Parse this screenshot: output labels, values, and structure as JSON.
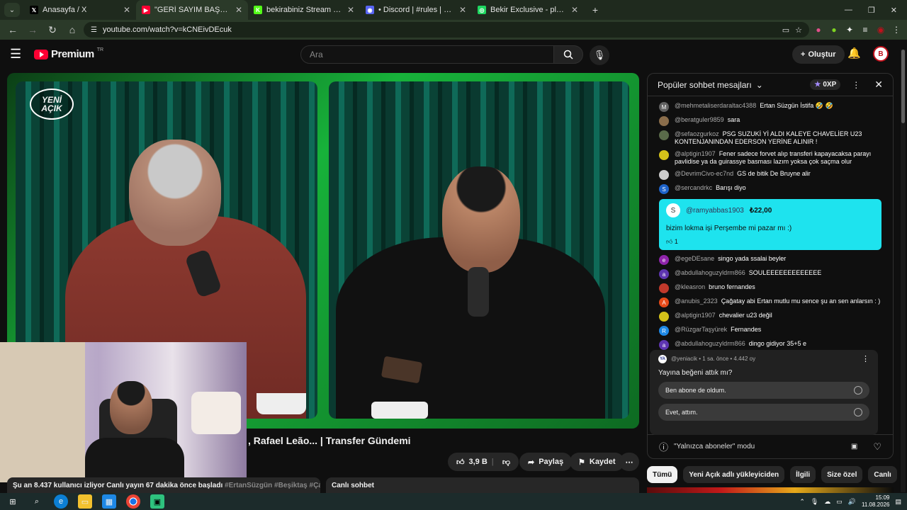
{
  "browser": {
    "tabs": [
      {
        "label": "Anasayfa / X",
        "icon": "x-logo-icon",
        "icon_glyph": "𝕏",
        "icon_bg": "#000000",
        "close": "✕"
      },
      {
        "label": "\"GERİ SAYIM BAŞLADI!\" Du",
        "icon": "youtube-icon",
        "icon_glyph": "▶",
        "icon_bg": "#ff0033",
        "close": "✕",
        "active": true
      },
      {
        "label": "bekirabiniz Stream - Watch Live",
        "icon": "kick-icon",
        "icon_glyph": "K",
        "icon_bg": "#53fc18",
        "close": "✕"
      },
      {
        "label": "• Discord | #rules | bekirabiniz",
        "icon": "discord-icon",
        "icon_glyph": "◉",
        "icon_bg": "#5865f2",
        "close": "✕"
      },
      {
        "label": "Bekir Exclusive - playlist by Bek",
        "icon": "spotify-icon",
        "icon_glyph": "◎",
        "icon_bg": "#1ed760",
        "close": "✕"
      }
    ],
    "new_tab": "+",
    "url": "youtube.com/watch?v=kCNEivDEcuk"
  },
  "header": {
    "logo_text": "Premium",
    "logo_region": "TR",
    "search_placeholder": "Ara",
    "create_label": "Oluştur"
  },
  "video": {
    "title": ", Rafael Leão... | Transfer Gündemi",
    "channel_watermark_line1": "YENİ",
    "channel_watermark_line2": "AÇIK",
    "like_count": "3,9 B",
    "share_label": "Paylaş",
    "save_label": "Kaydet",
    "description_line": "Şu an 8.437 kullanıcı izliyor  Canlı yayın 67 dakika önce başladı",
    "description_tags": "#ErtanSüzgün #Beşiktaş #ÇağataySö",
    "live_chat_label": "Canlı sohbet"
  },
  "chat": {
    "header_title": "Popüler sohbet mesajları",
    "xp_label": "0XP",
    "messages": [
      {
        "user": "@mehmetaliserdaraltac4388",
        "text": "Ertan Süzgün İstifa 🤣 🤣",
        "avatar": "M",
        "color": "#616161"
      },
      {
        "user": "@beratguler9859",
        "text": "sara",
        "avatar": "",
        "color": "#8a6d4b"
      },
      {
        "user": "@sefaozgurkoz",
        "text": "PSG SUZUKİ Yİ ALDI KALEYE CHAVELİER U23 KONTENJANINDAN EDERSON YERİNE ALINIR !",
        "avatar": "",
        "color": "#5a6b4a"
      },
      {
        "user": "@alptigin1907",
        "text": "Fener sadece forvet alıp transferi kapayacaksa parayı pavlidise ya da guirassye basması lazım yoksa çok saçma olur",
        "avatar": "",
        "color": "#d4c21a"
      },
      {
        "user": "@DevrimCivo-ec7nd",
        "text": "GS de bitik De Bruyne alir",
        "avatar": "",
        "color": "#cccccc"
      },
      {
        "user": "@sercandrkc",
        "text": "Barışı diyo",
        "avatar": "S",
        "color": "#1e63c9"
      }
    ],
    "superchat": {
      "user": "@ramyabbas1903",
      "amount": "₺22,00",
      "text": "bizim lokma işi Perşembe mi pazar mı :)",
      "likes": "1",
      "avatar": "S"
    },
    "messages_after": [
      {
        "user": "@egeDEsane",
        "text": "singo yada ssalai beyler",
        "avatar": "e",
        "color": "#8e24aa"
      },
      {
        "user": "@abdullahoguzyldrm866",
        "text": "SOULEEEEEEEEEEEEE",
        "avatar": "a",
        "color": "#5e35b1"
      },
      {
        "user": "@kleasron",
        "text": "bruno fernandes",
        "avatar": "",
        "color": "#c0392b"
      },
      {
        "user": "@anubis_2323",
        "text": "Çağatay abi Ertan mutlu mu sence şu an sen anlarsın : )",
        "avatar": "A",
        "color": "#e64a19"
      },
      {
        "user": "@alptigin1907",
        "text": "chevalier u23 değil",
        "avatar": "",
        "color": "#d4c21a"
      },
      {
        "user": "@RüzgarTaşyürek",
        "text": "Fernandes",
        "avatar": "R",
        "color": "#1e88e5"
      },
      {
        "user": "@abdullahoguzyldrm866",
        "text": "dingo gidiyor 35+5 e",
        "avatar": "a",
        "color": "#5e35b1"
      }
    ],
    "poll": {
      "meta": "@yeniacik • 1 sa. önce • 4.442 oy",
      "question": "Yayına beğeni attık mı?",
      "options": [
        "Ben abone de oldum.",
        "Evet, attım."
      ]
    },
    "input_mode": "\"Yalnızca aboneler\" modu"
  },
  "chips": [
    "Tümü",
    "Yeni Açık adlı yükleyiciden",
    "İlgili",
    "Size özel",
    "Canlı"
  ],
  "taskbar": {
    "time": "15:09",
    "date": "11.08.2026"
  }
}
